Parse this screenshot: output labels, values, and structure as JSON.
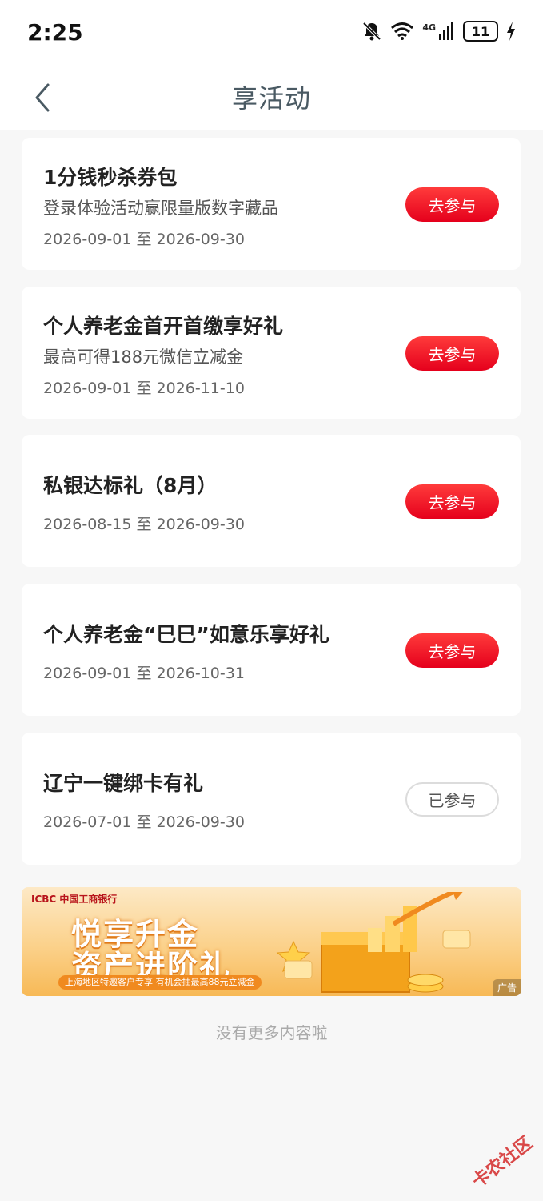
{
  "status": {
    "time": "2:25",
    "network": "4G",
    "battery": "11"
  },
  "header": {
    "title": "享活动"
  },
  "activities": [
    {
      "title": "1分钱秒杀券包",
      "desc": "登录体验活动赢限量版数字藏品",
      "date": "2026-09-01 至 2026-09-30",
      "action": "去参与"
    },
    {
      "title": "个人养老金首开首缴享好礼",
      "desc": "最高可得188元微信立减金",
      "date": "2026-09-01 至 2026-11-10",
      "action": "去参与"
    },
    {
      "title": "私银达标礼（8月）",
      "desc": "",
      "date": "2026-08-15 至 2026-09-30",
      "action": "去参与"
    },
    {
      "title": "个人养老金“巳巳”如意乐享好礼",
      "desc": "",
      "date": "2026-09-01 至 2026-10-31",
      "action": "去参与"
    },
    {
      "title": "辽宁一键绑卡有礼",
      "desc": "",
      "date": "2026-07-01 至 2026-09-30",
      "action": "已参与"
    }
  ],
  "banner": {
    "bank": "ICBC 中国工商银行",
    "line1": "悦享升金",
    "line2": "资产进阶礼",
    "subtitle": "上海地区特邀客户专享 有机会抽最高88元立减金",
    "ad_label": "广告"
  },
  "footer": {
    "end_text": "没有更多内容啦"
  },
  "watermark": "卡农社区",
  "colors": {
    "accent": "#e5001c",
    "background": "#f7f7f7",
    "title": "#4a5a63"
  }
}
